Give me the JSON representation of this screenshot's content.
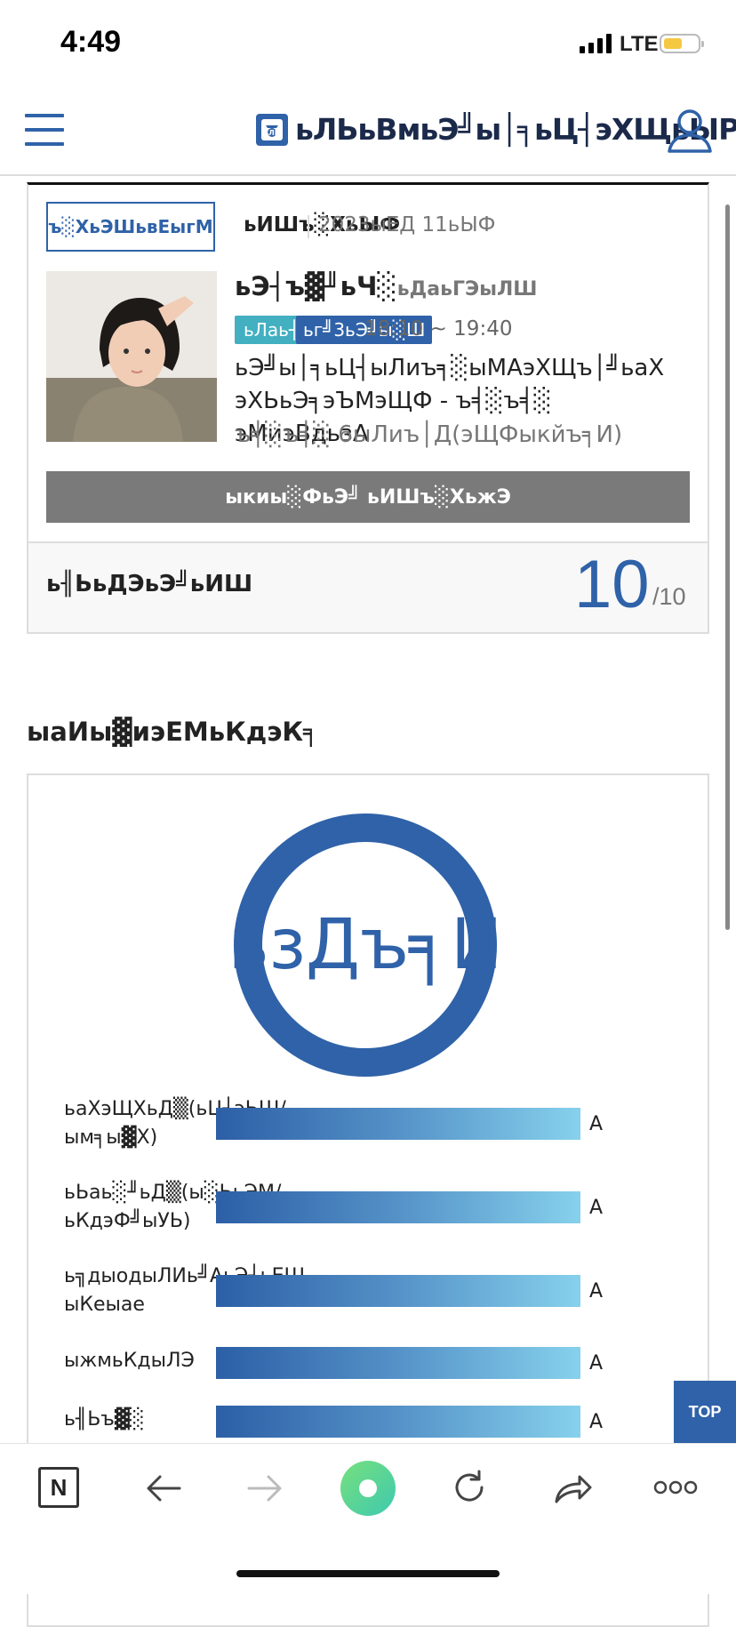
{
  "status_bar": {
    "time": "4:49",
    "network": "LTE"
  },
  "header": {
    "logo_mark": "ЁЯЫС",
    "brand": "ьЛЬьВмьЭ╝ы│╕ьЦ┤эХЩьЫР"
  },
  "course_card": {
    "status_button": "ъ░ХьЭШьвЕыгМ",
    "month_label": "ьИШъ░ХьЫФ",
    "month_value": "2023ыЕД 11ьЫФ",
    "teacher_name": "ьЭ┤ъ▓╜ьЧ░",
    "teacher_suffix": "ьДаьГЭыЛШ",
    "tag_location": "ьЛаь┤М",
    "tag_class": "ьг╝3ьЭ╝ы░Ш",
    "time": "18:10 ~ 19:40",
    "course_title": "ьЭ╝ы│╕ьЦ┤ыЛиъ╕░ыМАэХЩъ│╝ьаХ эХЬьЭ╕эЪМэЩФ - ъ╡░ъ╡░ эМиэВдьзА",
    "level": "ъ╡░ъ╡░ 6ыЛиъ│Д(эЩФыкйъ╕И)",
    "mobile_button": "ыкиы░ФьЭ╝ ьИШъ░ХьжЭ"
  },
  "attendance": {
    "label": "ь╢ЬьДЭьЭ╝ьИШ",
    "value": "10",
    "total": "/10"
  },
  "level_test": {
    "title": "ыаИы▓иэЕМьКдэК╕",
    "result": "ьзДъ╕Й",
    "criteria": [
      {
        "label": "ьаХэЩХьД▒(ьЦ┤эЬШ/ым╕ы▓Х)",
        "grade": "A"
      },
      {
        "label": "ьЬаь░╜ьД▒(ы░ЬьЭМ/ьКдэФ╝ыУЬ)",
        "grade": "A"
      },
      {
        "label": "ь╗дыодыЛИь╝АьЭ┤ьЕШ ыКеыае",
        "grade": "A"
      },
      {
        "label": "ыжмьКдыЛЭ",
        "grade": "A"
      },
      {
        "label": "ь╢Ьъ▓░",
        "grade": "A"
      }
    ]
  },
  "top_button": "TOP",
  "bottom_bar": {
    "naver_label": "N"
  },
  "colors": {
    "primary": "#2f62a8",
    "teal": "#42b0c1",
    "gray_button": "#7a7a7a",
    "green": "#5fd68f"
  }
}
